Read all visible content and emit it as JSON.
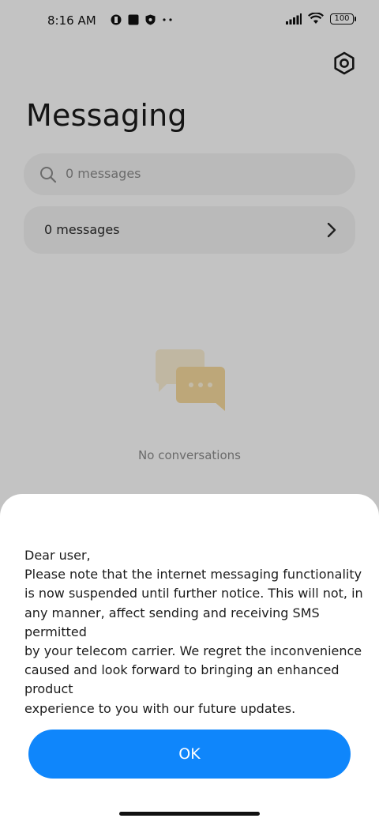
{
  "status_bar": {
    "time": "8:16 AM",
    "battery": "100"
  },
  "header": {
    "title": "Messaging"
  },
  "search": {
    "placeholder": "0 messages"
  },
  "message_row": {
    "label": "0 messages"
  },
  "empty_state": {
    "text": "No conversations"
  },
  "dialog": {
    "body": "Dear user,\nPlease note that the internet messaging functionality\nis now suspended until further notice. This will not, in\nany manner, affect sending and receiving SMS permitted\nby your telecom carrier. We regret the inconvenience\ncaused and look forward to bringing an enhanced product\nexperience to you with our future updates.",
    "ok_label": "OK"
  },
  "colors": {
    "accent": "#0f86fb",
    "sheet_bg": "#ffffff",
    "illustration": "#f2d79b"
  },
  "icons": [
    "settings-gear-icon",
    "search-icon",
    "chevron-right-icon",
    "chat-bubbles-icon",
    "signal-icon",
    "wifi-icon",
    "battery-icon"
  ]
}
